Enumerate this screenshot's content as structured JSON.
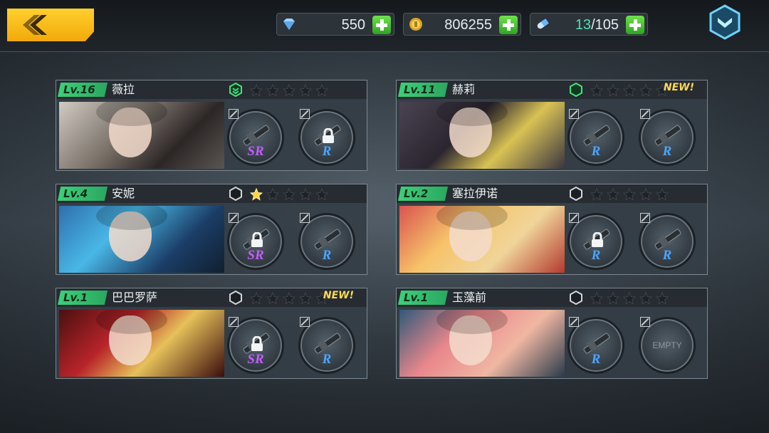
{
  "header": {
    "diamonds": "550",
    "gold": "806255",
    "stamina_current": "13",
    "stamina_max": "/105"
  },
  "cards": [
    {
      "level": "Lv.16",
      "name": "薇拉",
      "stars": 0,
      "new": "",
      "rank": "green-active",
      "slot1": {
        "grade": "SR",
        "locked": false,
        "color": "#c45cff"
      },
      "slot2": {
        "grade": "R",
        "locked": true,
        "color": "#4aa6ff"
      }
    },
    {
      "level": "Lv.11",
      "name": "赫莉",
      "stars": 0,
      "new": "NEW!",
      "rank": "green",
      "slot1": {
        "grade": "R",
        "locked": false,
        "color": "#4aa6ff"
      },
      "slot2": {
        "grade": "R",
        "locked": false,
        "color": "#4aa6ff"
      }
    },
    {
      "level": "Lv.4",
      "name": "安妮",
      "stars": 1,
      "new": "",
      "rank": "gray",
      "slot1": {
        "grade": "SR",
        "locked": true,
        "color": "#c45cff"
      },
      "slot2": {
        "grade": "R",
        "locked": false,
        "color": "#4aa6ff"
      }
    },
    {
      "level": "Lv.2",
      "name": "塞拉伊诺",
      "stars": 0,
      "new": "",
      "rank": "gray",
      "slot1": {
        "grade": "R",
        "locked": true,
        "color": "#4aa6ff"
      },
      "slot2": {
        "grade": "R",
        "locked": false,
        "color": "#4aa6ff"
      }
    },
    {
      "level": "Lv.1",
      "name": "巴巴罗萨",
      "stars": 0,
      "new": "NEW!",
      "rank": "gray",
      "slot1": {
        "grade": "SR",
        "locked": true,
        "color": "#c45cff"
      },
      "slot2": {
        "grade": "R",
        "locked": false,
        "color": "#4aa6ff"
      }
    },
    {
      "level": "Lv.1",
      "name": "玉藻前",
      "stars": 0,
      "new": "",
      "rank": "gray",
      "slot1": {
        "grade": "R",
        "locked": false,
        "color": "#4aa6ff"
      },
      "slot2": {
        "grade": "",
        "locked": false,
        "empty": "EMPTY",
        "color": "#8b959c"
      }
    }
  ],
  "icons": {
    "back": "chevron-left-icon",
    "diamond": "diamond-icon",
    "gold": "gold-coin-icon",
    "stamina": "stamina-capsule-icon",
    "menu": "menu-chevron-icon",
    "lock": "lock-icon",
    "star": "star-icon",
    "rank": "rank-hexagon-icon"
  },
  "colors": {
    "accent": "#f6b915",
    "level": "#36c06f",
    "plus": "#4cc23a",
    "star_on": "#ffd23a"
  }
}
